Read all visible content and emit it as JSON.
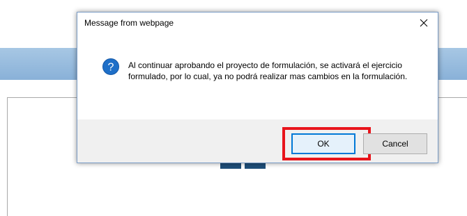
{
  "dialog": {
    "title": "Message from webpage",
    "icon": "question-icon",
    "message": "Al continuar aprobando el proyecto de formulación, se activará el ejercicio formulado, por lo cual, ya no podrá realizar mas cambios en la formulación.",
    "ok_label": "OK",
    "cancel_label": "Cancel",
    "highlight_color": "#e8141b",
    "accent_color": "#0078d7"
  },
  "background": {
    "header_color": "#a7c7e4"
  }
}
